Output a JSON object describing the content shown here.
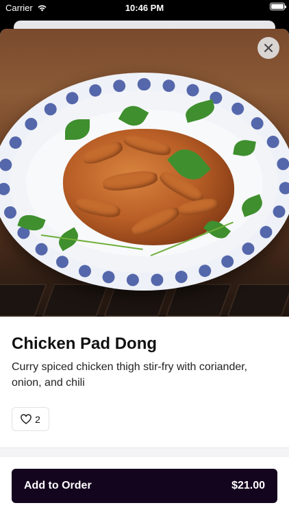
{
  "status_bar": {
    "carrier": "Carrier",
    "time": "10:46 PM",
    "battery_level": 1.0
  },
  "item": {
    "title": "Chicken Pad Dong",
    "description": "Curry spiced chicken thigh stir-fry with coriander, onion, and chili",
    "likes": "2",
    "image_icon": "food-photo"
  },
  "actions": {
    "add_to_order_label": "Add to Order",
    "price": "$21.00"
  },
  "colors": {
    "order_button": "#14051f",
    "plate_pattern": "#3b4f9e",
    "background": "#ffffff"
  }
}
